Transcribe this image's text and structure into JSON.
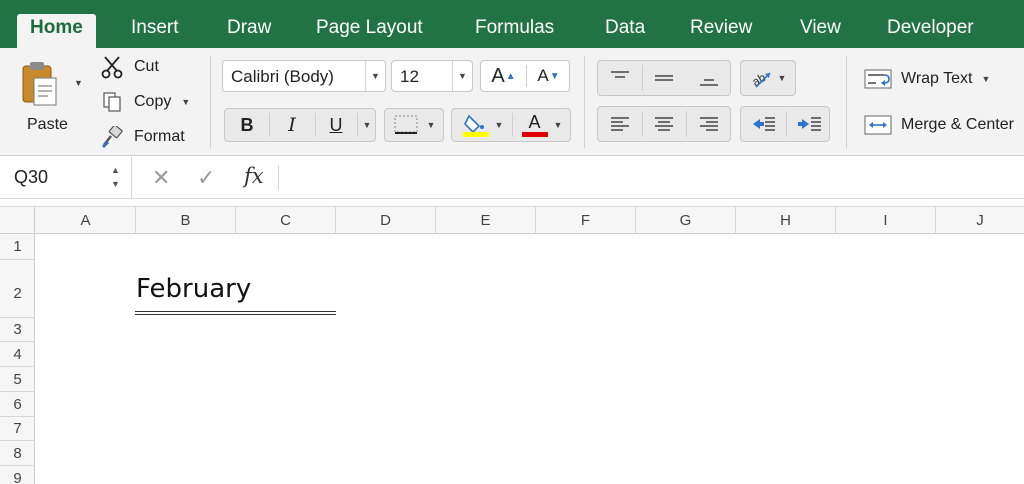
{
  "tabs": [
    {
      "label": "Home",
      "active": true
    },
    {
      "label": "Insert"
    },
    {
      "label": "Draw"
    },
    {
      "label": "Page Layout"
    },
    {
      "label": "Formulas"
    },
    {
      "label": "Data"
    },
    {
      "label": "Review"
    },
    {
      "label": "View"
    },
    {
      "label": "Developer"
    }
  ],
  "clipboard": {
    "paste_label": "Paste",
    "cut_label": "Cut",
    "copy_label": "Copy",
    "format_label": "Format"
  },
  "font": {
    "name": "Calibri (Body)",
    "size": "12",
    "increase_glyph": "A",
    "decrease_glyph": "A",
    "bold_glyph": "B",
    "italic_glyph": "I",
    "underline_glyph": "U",
    "font_color_glyph": "A",
    "fill_color": "#ffff00",
    "font_color": "#e00000"
  },
  "alignment": {
    "wrap_text_label": "Wrap Text",
    "merge_center_label": "Merge & Center"
  },
  "formula_bar": {
    "name_box": "Q30",
    "cancel_glyph": "✕",
    "enter_glyph": "✓",
    "fx_label": "fx",
    "content": ""
  },
  "grid": {
    "columns": [
      "A",
      "B",
      "C",
      "D",
      "E",
      "F",
      "G",
      "H",
      "I",
      "J"
    ],
    "rows": [
      "1",
      "2",
      "3",
      "4",
      "5",
      "6",
      "7",
      "8",
      "9"
    ],
    "cells": {
      "B2": "February"
    }
  },
  "colors": {
    "tab_bar": "#217346",
    "ribbon": "#f3f3f3"
  }
}
